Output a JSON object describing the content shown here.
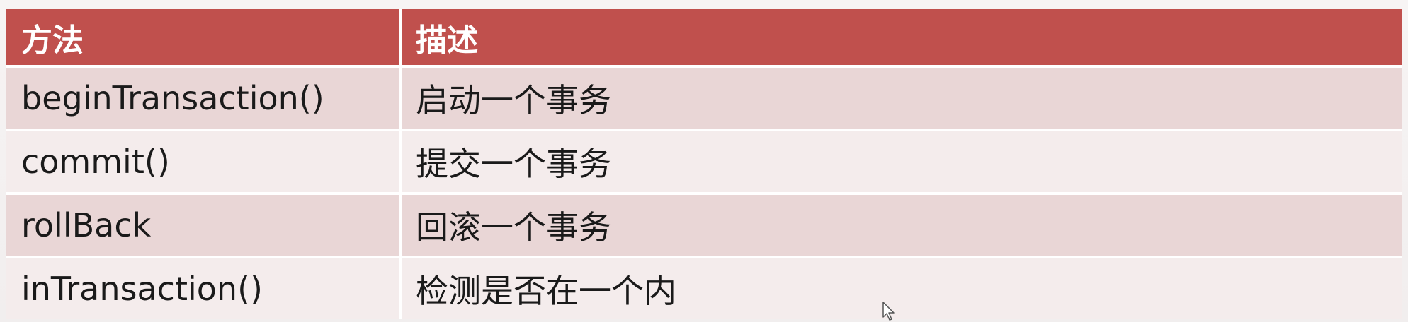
{
  "table": {
    "headers": [
      "方法",
      "描述"
    ],
    "rows": [
      {
        "method": "beginTransaction()",
        "description": "启动一个事务"
      },
      {
        "method": "commit()",
        "description": "提交一个事务"
      },
      {
        "method": "rollBack",
        "description": "回滚一个事务"
      },
      {
        "method": "inTransaction()",
        "description": "检测是否在一个内"
      }
    ]
  },
  "colors": {
    "header_bg": "#c0504d",
    "header_text": "#ffffff",
    "row_odd_bg": "#e9d6d6",
    "row_even_bg": "#f4ecec"
  },
  "icons": {
    "cursor": "mouse-pointer-icon"
  }
}
